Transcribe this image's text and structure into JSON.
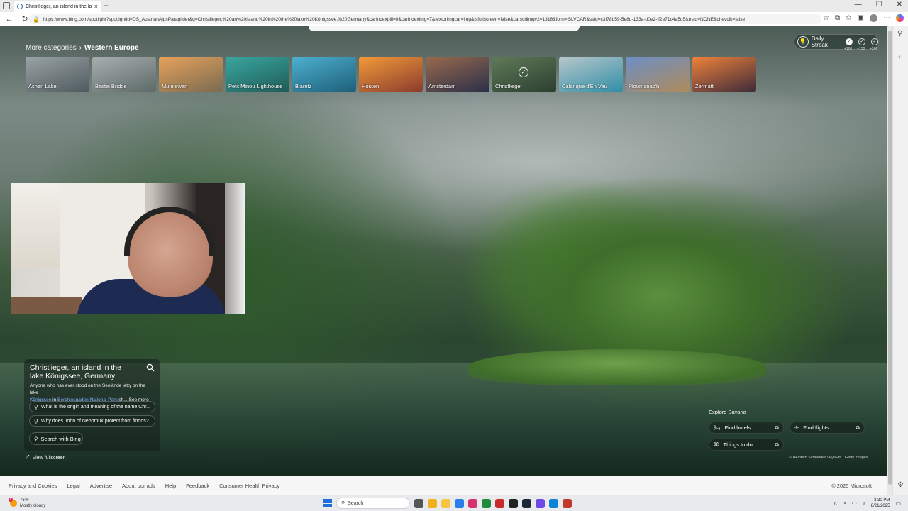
{
  "browser": {
    "tab_title": "Christlieger, an island in the lake",
    "url": "https://www.bing.com/spotlight?spotlightid=DS_AustrianAlpsParaglider&q=Christlieger,%20an%20island%20in%20the%20lake%20Königssee,%20Germany&carindexpill=0&carindeximg=7&textorimgcar=img&isfullscreen=false&carscrlimgv2=1316&form=SLVCAR&ssid=c3f78b59-5e8d-133a-d0e2-ff2e71c4a5d5&trsid=NONE&chevclk=false"
  },
  "breadcrumb": {
    "parent": "More categories",
    "current": "Western Europe"
  },
  "carousel": [
    {
      "label": "Achen Lake",
      "c1": "#9aa3a6",
      "c2": "#4f5a5e",
      "selected": false
    },
    {
      "label": "Bastei Bridge",
      "c1": "#a9aeb0",
      "c2": "#5c6a66",
      "selected": false
    },
    {
      "label": "Mute swan",
      "c1": "#e6a25a",
      "c2": "#7a6a52",
      "selected": false
    },
    {
      "label": "Petit Minou Lighthouse",
      "c1": "#3aa7a0",
      "c2": "#1f5b57",
      "selected": false
    },
    {
      "label": "Biarritz",
      "c1": "#4cb1d0",
      "c2": "#1e5e78",
      "selected": false
    },
    {
      "label": "Houten",
      "c1": "#f29a3a",
      "c2": "#8a3c2c",
      "selected": false
    },
    {
      "label": "Amsterdam",
      "c1": "#9a6a4e",
      "c2": "#2a2f48",
      "selected": false
    },
    {
      "label": "Christlieger",
      "c1": "#5f7a58",
      "c2": "#2c3f2f",
      "selected": true
    },
    {
      "label": "Calanque d'En Vau",
      "c1": "#b9c7cc",
      "c2": "#2f8ea5",
      "selected": false
    },
    {
      "label": "Ploumanac'h",
      "c1": "#6c8fc7",
      "c2": "#b08a5a",
      "selected": false
    },
    {
      "label": "Zermatt",
      "c1": "#f0823a",
      "c2": "#3c2a3a",
      "selected": false
    }
  ],
  "streak": {
    "label": "Daily Streak",
    "points": [
      "+100",
      "+150",
      "+200"
    ]
  },
  "info": {
    "title": "Christlieger, an island in the lake Königssee, Germany",
    "desc_prefix": "Anyone who has ever stood on the Seelände jetty on the lake",
    "link1": "Königssee",
    "desc_mid": " in ",
    "link2": "Berchtesgaden National Park",
    "desc_suffix": " sh...",
    "see_more": "See more",
    "questions": [
      "What is the origin and meaning of the name Chr...",
      "Why does John of Nepomuk protect from floods?"
    ],
    "search_label": "Search with Bing"
  },
  "view_fullscreen": "View fullscreen",
  "explore": {
    "heading": "Explore Bavaria",
    "hotels": "Find hotels",
    "flights": "Find flights",
    "things": "Things to do"
  },
  "credit": "© Heinrich Schneider / EyeEm / Getty Images",
  "footer": {
    "links": [
      "Privacy and Cookies",
      "Legal",
      "Advertise",
      "About our ads",
      "Help",
      "Feedback",
      "Consumer Health Privacy"
    ],
    "copyright": "© 2025 Microsoft"
  },
  "taskbar": {
    "weather_badge": "6",
    "temp": "76°F",
    "condition": "Mostly cloudy",
    "search": "Search",
    "time": "3:30 PM",
    "date": "8/21/2025"
  }
}
